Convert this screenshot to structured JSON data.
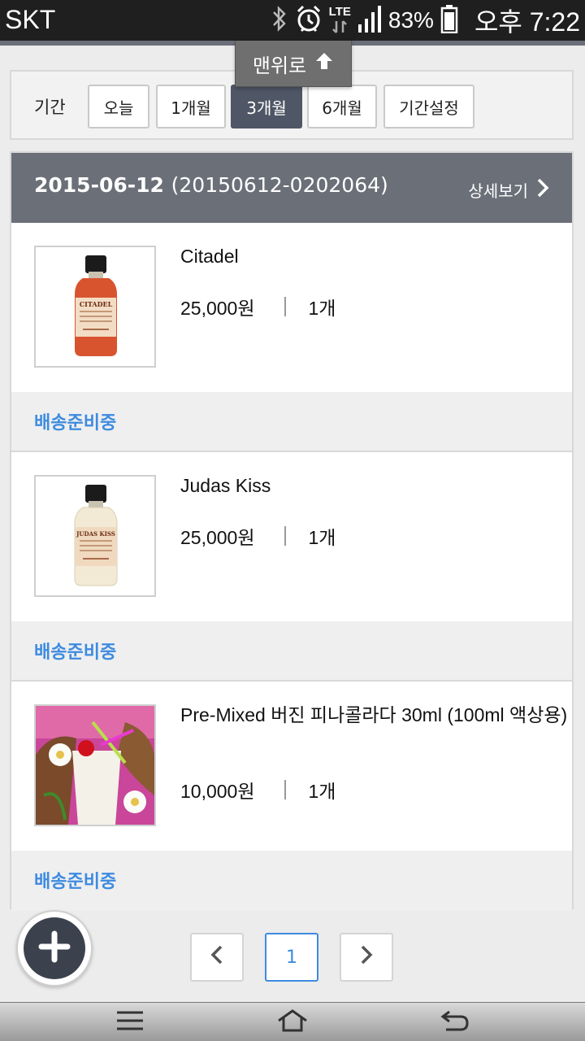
{
  "status_bar": {
    "carrier": "SKT",
    "network": "LTE",
    "battery_percent": "83%",
    "time": "오후 7:22",
    "icons": [
      "bluetooth-icon",
      "alarm-icon",
      "signal-icon",
      "battery-icon"
    ]
  },
  "to_top_button": {
    "label": "맨위로",
    "icon": "arrow-up-icon"
  },
  "period_filter": {
    "label": "기간",
    "options": [
      "오늘",
      "1개월",
      "3개월",
      "6개월",
      "기간설정"
    ],
    "selected": "3개월"
  },
  "order": {
    "date": "2015-06-12",
    "order_number": "(20150612-0202064)",
    "detail_label": "상세보기",
    "items": [
      {
        "name": "Citadel",
        "price": "25,000원",
        "quantity": "1개",
        "status": "배송준비중",
        "image": "citadel-bottle-image",
        "thumb_label": "CITADEL"
      },
      {
        "name": "Judas Kiss",
        "price": "25,000원",
        "quantity": "1개",
        "status": "배송준비중",
        "image": "judas-kiss-bottle-image",
        "thumb_label": "JUDAS KISS"
      },
      {
        "name": "Pre-Mixed 버진 피나콜라다 30ml (100ml 액상용)",
        "price": "10,000원",
        "quantity": "1개",
        "status": "배송준비중",
        "image": "pina-colada-image"
      }
    ]
  },
  "pagination": {
    "prev_icon": "chevron-left-icon",
    "current_page": "1",
    "next_icon": "chevron-right-icon"
  },
  "fab": {
    "icon": "plus-icon"
  },
  "nav_bar": {
    "icons": [
      "menu-icon",
      "home-icon",
      "back-icon"
    ]
  },
  "colors": {
    "header": "#6b6f78",
    "active_tab": "#4f5665",
    "status_blue": "#3d8be0"
  }
}
